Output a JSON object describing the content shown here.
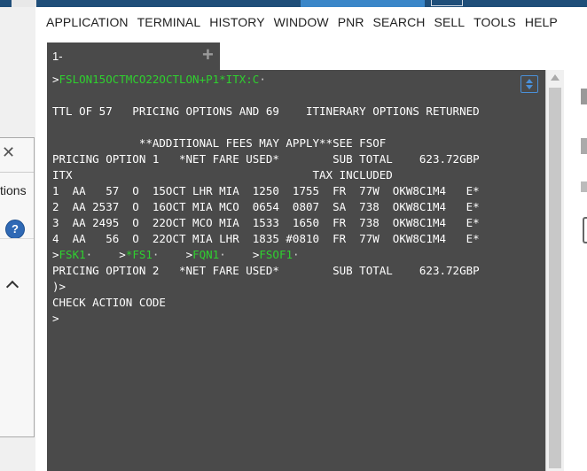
{
  "menu": [
    "APPLICATION",
    "TERMINAL",
    "HISTORY",
    "WINDOW",
    "PNR",
    "SEARCH",
    "SELL",
    "TOOLS",
    "HELP"
  ],
  "tab": {
    "label": "1-",
    "add_icon": "plus-icon"
  },
  "popup": {
    "text": "tions",
    "help": "?",
    "close_icon": "close-icon",
    "chevron_icon": "chevron-up-icon"
  },
  "terminal": {
    "command": "FSLON15OCTMCO22OCTLON+P1*ITX:C",
    "ttl": "TTL OF 57   PRICING OPTIONS AND 69    ITINERARY OPTIONS RETURNED",
    "fees": "             **ADDITIONAL FEES MAY APPLY**SEE FSOF",
    "opt1": "PRICING OPTION 1   *NET FARE USED*        SUB TOTAL    623.72GBP",
    "itx": "ITX                                    TAX INCLUDED",
    "segments": [
      "1  AA   57  O  15OCT LHR MIA  1250  1755  FR  77W  OKW8C1M4   E*",
      "2  AA 2537  O  16OCT MIA MCO  0654  0807  SA  738  OKW8C1M4   E*",
      "3  AA 2495  O  22OCT MCO MIA  1533  1650  FR  738  OKW8C1M4   E*",
      "4  AA   56  O  22OCT MIA LHR  1835 #0810  FR  77W  OKW8C1M4   E*"
    ],
    "links": [
      "FSK1",
      "*FS1",
      "FQN1",
      "FSOF1"
    ],
    "opt2": "PRICING OPTION 2   *NET FARE USED*        SUB TOTAL    623.72GBP",
    "more": ")>",
    "check": "CHECK ACTION CODE",
    "prompt": ">"
  }
}
